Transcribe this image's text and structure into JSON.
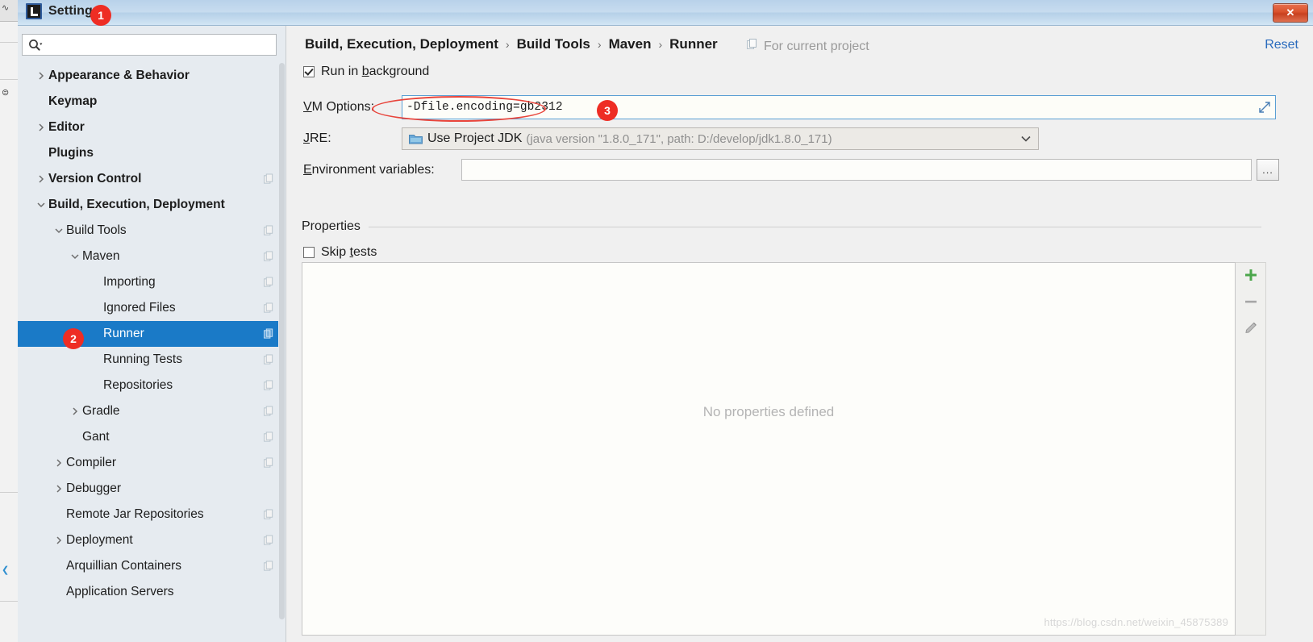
{
  "window": {
    "title": "Settings",
    "app_icon": "intellij-idea-icon",
    "close_label": "✕"
  },
  "search": {
    "value": "",
    "placeholder": "",
    "icon": "search-icon"
  },
  "sidebar": {
    "items": [
      {
        "label": "Appearance & Behavior",
        "depth": 0,
        "arrow": "right",
        "bold": true,
        "badge": false,
        "selected": false
      },
      {
        "label": "Keymap",
        "depth": 0,
        "arrow": "none",
        "bold": true,
        "badge": false,
        "selected": false
      },
      {
        "label": "Editor",
        "depth": 0,
        "arrow": "right",
        "bold": true,
        "badge": false,
        "selected": false
      },
      {
        "label": "Plugins",
        "depth": 0,
        "arrow": "none",
        "bold": true,
        "badge": false,
        "selected": false
      },
      {
        "label": "Version Control",
        "depth": 0,
        "arrow": "right",
        "bold": true,
        "badge": true,
        "selected": false
      },
      {
        "label": "Build, Execution, Deployment",
        "depth": 0,
        "arrow": "down",
        "bold": true,
        "badge": false,
        "selected": false
      },
      {
        "label": "Build Tools",
        "depth": 1,
        "arrow": "down",
        "bold": false,
        "badge": true,
        "selected": false
      },
      {
        "label": "Maven",
        "depth": 2,
        "arrow": "down",
        "bold": false,
        "badge": true,
        "selected": false
      },
      {
        "label": "Importing",
        "depth": 3,
        "arrow": "none",
        "bold": false,
        "badge": true,
        "selected": false
      },
      {
        "label": "Ignored Files",
        "depth": 3,
        "arrow": "none",
        "bold": false,
        "badge": true,
        "selected": false
      },
      {
        "label": "Runner",
        "depth": 3,
        "arrow": "none",
        "bold": false,
        "badge": true,
        "selected": true
      },
      {
        "label": "Running Tests",
        "depth": 3,
        "arrow": "none",
        "bold": false,
        "badge": true,
        "selected": false
      },
      {
        "label": "Repositories",
        "depth": 3,
        "arrow": "none",
        "bold": false,
        "badge": true,
        "selected": false
      },
      {
        "label": "Gradle",
        "depth": 2,
        "arrow": "right",
        "bold": false,
        "badge": true,
        "selected": false
      },
      {
        "label": "Gant",
        "depth": 2,
        "arrow": "none",
        "bold": false,
        "badge": true,
        "selected": false
      },
      {
        "label": "Compiler",
        "depth": 1,
        "arrow": "right",
        "bold": false,
        "badge": true,
        "selected": false
      },
      {
        "label": "Debugger",
        "depth": 1,
        "arrow": "right",
        "bold": false,
        "badge": false,
        "selected": false
      },
      {
        "label": "Remote Jar Repositories",
        "depth": 1,
        "arrow": "none",
        "bold": false,
        "badge": true,
        "selected": false
      },
      {
        "label": "Deployment",
        "depth": 1,
        "arrow": "right",
        "bold": false,
        "badge": true,
        "selected": false
      },
      {
        "label": "Arquillian Containers",
        "depth": 1,
        "arrow": "none",
        "bold": false,
        "badge": true,
        "selected": false
      },
      {
        "label": "Application Servers",
        "depth": 1,
        "arrow": "none",
        "bold": false,
        "badge": false,
        "selected": false
      }
    ]
  },
  "breadcrumb": {
    "crumbs": [
      "Build, Execution, Deployment",
      "Build Tools",
      "Maven",
      "Runner"
    ],
    "separator": "›",
    "scope_label": "For current project",
    "scope_icon": "copy-icon",
    "reset_label": "Reset"
  },
  "form": {
    "run_in_background": {
      "label_a": "Run in ",
      "label_u": "b",
      "label_b": "ackground",
      "checked": true
    },
    "vm_options": {
      "label_u": "V",
      "label_rest": "M Options:",
      "value": "-Dfile.encoding=gb2312",
      "expand_icon": "expand-icon"
    },
    "jre": {
      "label_u": "J",
      "label_rest": "RE:",
      "main": "Use Project JDK",
      "sub": "(java version \"1.8.0_171\", path: D:/develop/jdk1.8.0_171)",
      "icon": "folder-icon",
      "arrow_icon": "chevron-down-icon"
    },
    "environment_variables": {
      "label_u": "E",
      "label_rest": "nvironment variables:",
      "value": "",
      "browse_label": "..."
    },
    "properties_section": "Properties",
    "skip_tests": {
      "label_a": "Skip ",
      "label_u": "t",
      "label_b": "ests",
      "checked": false
    },
    "properties_empty": "No properties defined",
    "toolbar": [
      {
        "name": "add-property-button",
        "icon": "plus-icon",
        "color": "#4ba64b"
      },
      {
        "name": "remove-property-button",
        "icon": "minus-icon",
        "color": "#9a9a9a"
      },
      {
        "name": "edit-property-button",
        "icon": "pencil-icon",
        "color": "#9a9a9a"
      }
    ]
  },
  "annotations": [
    {
      "number": "1",
      "target": "window-title"
    },
    {
      "number": "2",
      "target": "sidebar-item-runner"
    },
    {
      "number": "3",
      "target": "vm-options-input"
    }
  ],
  "watermark": "https://blog.csdn.net/weixin_45875389",
  "colors": {
    "selection_blue": "#1a7ac7",
    "annotation_red": "#ee2d24",
    "link_blue": "#2a6bbd",
    "focus_border": "#5a9fd4"
  }
}
